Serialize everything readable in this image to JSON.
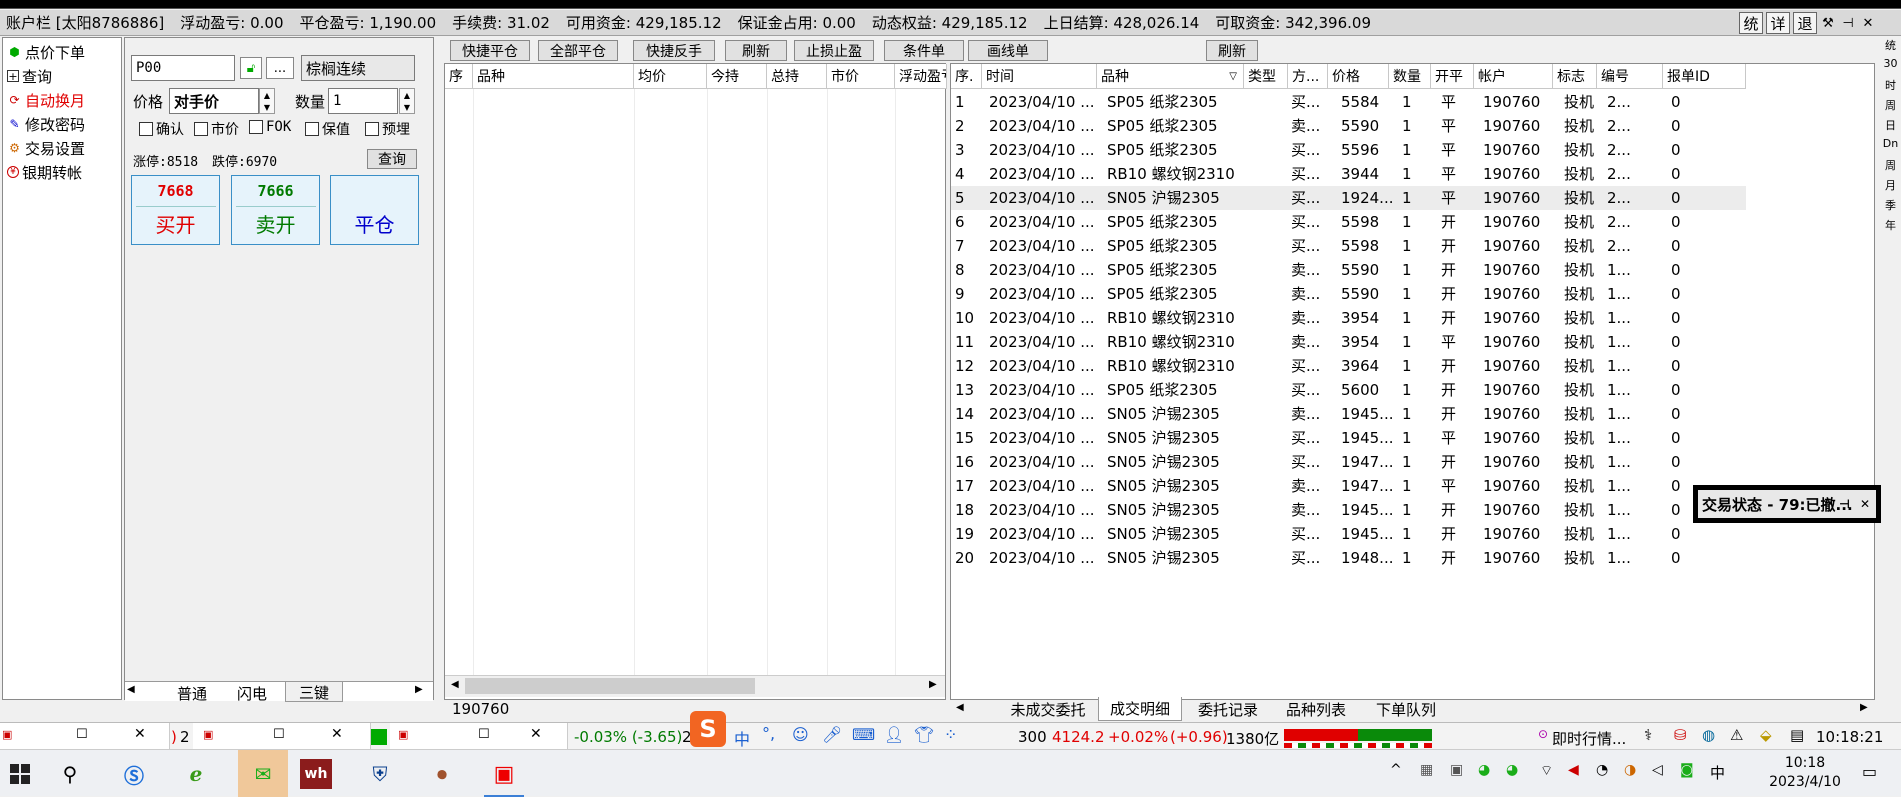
{
  "account_bar": {
    "title": "账户栏 [太阳8786886]",
    "floating_pl": "浮动盈亏: 0.00",
    "close_pl": "平仓盈亏: 1,190.00",
    "fee": "手续费: 31.02",
    "available": "可用资金: 429,185.12",
    "margin": "保证金占用: 0.00",
    "dynamic_equity": "动态权益: 429,185.12",
    "prev_settle": "上日结算: 428,026.14",
    "withdrawable": "可取资金: 342,396.09",
    "btn_stat": "统",
    "btn_detail": "详",
    "btn_exit": "退"
  },
  "left_nav": {
    "items": [
      {
        "label": "点价下单",
        "icon": "green-dot-icon",
        "color": "#000000"
      },
      {
        "label": "查询",
        "icon": "plus-box-icon",
        "color": "#000000"
      },
      {
        "label": "自动换月",
        "icon": "cycle-icon",
        "color": "#e00000"
      },
      {
        "label": "修改密码",
        "icon": "edit-icon",
        "color": "#000000"
      },
      {
        "label": "交易设置",
        "icon": "gear-icon",
        "color": "#000000"
      },
      {
        "label": "银期转帐",
        "icon": "money-icon",
        "color": "#000000"
      }
    ]
  },
  "order_panel": {
    "contract_code": "P00",
    "contract_name": "棕榈连续",
    "more": "...",
    "price_label": "价格",
    "price_value": "对手价",
    "qty_label": "数量",
    "qty_value": "1",
    "checks": [
      "确认",
      "市价",
      "FOK",
      "保值",
      "预埋"
    ],
    "limit_up": "涨停:8518",
    "limit_down": "跌停:6970",
    "query_btn": "查询",
    "buy_price": "7668",
    "buy_label": "买开",
    "sell_price": "7666",
    "sell_label": "卖开",
    "close_label": "平仓",
    "tabs": [
      "普通",
      "闪电",
      "三键"
    ],
    "account_no": "190760"
  },
  "toolbar": {
    "quick_close": "快捷平仓",
    "close_all": "全部平仓",
    "quick_reverse": "快捷反手",
    "refresh": "刷新",
    "stop": "止损止盈",
    "conditional": "条件单",
    "draw": "画线单",
    "refresh2": "刷新"
  },
  "positions_table": {
    "headers": [
      "序",
      "品种",
      "均价",
      "今持",
      "总持",
      "市价",
      "浮动盈亏"
    ]
  },
  "trades_table": {
    "headers": [
      "序.",
      "时间",
      "品种",
      "类型",
      "方...",
      "价格",
      "数量",
      "开平",
      "帐户",
      "标志",
      "编号",
      "报单ID"
    ],
    "rows": [
      [
        "1",
        "2023/04/10 ...",
        "SP05 纸浆2305",
        "",
        "买...",
        "5584",
        "1",
        "平",
        "190760",
        "投机",
        "2...",
        "0"
      ],
      [
        "2",
        "2023/04/10 ...",
        "SP05 纸浆2305",
        "",
        "卖...",
        "5590",
        "1",
        "平",
        "190760",
        "投机",
        "2...",
        "0"
      ],
      [
        "3",
        "2023/04/10 ...",
        "SP05 纸浆2305",
        "",
        "买...",
        "5596",
        "1",
        "平",
        "190760",
        "投机",
        "2...",
        "0"
      ],
      [
        "4",
        "2023/04/10 ...",
        "RB10 螺纹钢2310",
        "",
        "买...",
        "3944",
        "1",
        "平",
        "190760",
        "投机",
        "2...",
        "0"
      ],
      [
        "5",
        "2023/04/10 ...",
        "SN05 沪锡2305",
        "",
        "买...",
        "1924...",
        "1",
        "平",
        "190760",
        "投机",
        "2...",
        "0"
      ],
      [
        "6",
        "2023/04/10 ...",
        "SP05 纸浆2305",
        "",
        "买...",
        "5598",
        "1",
        "开",
        "190760",
        "投机",
        "2...",
        "0"
      ],
      [
        "7",
        "2023/04/10 ...",
        "SP05 纸浆2305",
        "",
        "买...",
        "5598",
        "1",
        "开",
        "190760",
        "投机",
        "2...",
        "0"
      ],
      [
        "8",
        "2023/04/10 ...",
        "SP05 纸浆2305",
        "",
        "卖...",
        "5590",
        "1",
        "开",
        "190760",
        "投机",
        "1...",
        "0"
      ],
      [
        "9",
        "2023/04/10 ...",
        "SP05 纸浆2305",
        "",
        "卖...",
        "5590",
        "1",
        "开",
        "190760",
        "投机",
        "1...",
        "0"
      ],
      [
        "10",
        "2023/04/10 ...",
        "RB10 螺纹钢2310",
        "",
        "卖...",
        "3954",
        "1",
        "开",
        "190760",
        "投机",
        "1...",
        "0"
      ],
      [
        "11",
        "2023/04/10 ...",
        "RB10 螺纹钢2310",
        "",
        "卖...",
        "3954",
        "1",
        "平",
        "190760",
        "投机",
        "1...",
        "0"
      ],
      [
        "12",
        "2023/04/10 ...",
        "RB10 螺纹钢2310",
        "",
        "买...",
        "3964",
        "1",
        "开",
        "190760",
        "投机",
        "1...",
        "0"
      ],
      [
        "13",
        "2023/04/10 ...",
        "SP05 纸浆2305",
        "",
        "买...",
        "5600",
        "1",
        "开",
        "190760",
        "投机",
        "1...",
        "0"
      ],
      [
        "14",
        "2023/04/10 ...",
        "SN05 沪锡2305",
        "",
        "卖...",
        "1945...",
        "1",
        "开",
        "190760",
        "投机",
        "1...",
        "0"
      ],
      [
        "15",
        "2023/04/10 ...",
        "SN05 沪锡2305",
        "",
        "买...",
        "1945...",
        "1",
        "平",
        "190760",
        "投机",
        "1...",
        "0"
      ],
      [
        "16",
        "2023/04/10 ...",
        "SN05 沪锡2305",
        "",
        "买...",
        "1947...",
        "1",
        "开",
        "190760",
        "投机",
        "1...",
        "0"
      ],
      [
        "17",
        "2023/04/10 ...",
        "SN05 沪锡2305",
        "",
        "卖...",
        "1947...",
        "1",
        "平",
        "190760",
        "投机",
        "1...",
        "0"
      ],
      [
        "18",
        "2023/04/10 ...",
        "SN05 沪锡2305",
        "",
        "卖...",
        "1945...",
        "1",
        "开",
        "190760",
        "投机",
        "1...",
        "0"
      ],
      [
        "19",
        "2023/04/10 ...",
        "SN05 沪锡2305",
        "",
        "买...",
        "1945...",
        "1",
        "开",
        "190760",
        "投机",
        "1...",
        "0"
      ],
      [
        "20",
        "2023/04/10 ...",
        "SN05 沪锡2305",
        "",
        "买...",
        "1948...",
        "1",
        "开",
        "190760",
        "投机",
        "1...",
        "0"
      ]
    ]
  },
  "bottom_tabs": [
    "未成交委托",
    "成交明细",
    "委托记录",
    "品种列表",
    "下单队列"
  ],
  "popup": {
    "text": "交易状态 - 79:已撤...",
    "pin": "⊣",
    "close": "✕"
  },
  "status_strip": {
    "left_red": ")",
    "left_num": "2",
    "change_pct": "-0.03% (-3.65)",
    "mid_num": "2",
    "index_code": "300",
    "index_value": "4124.2",
    "index_pct": "+0.02%",
    "index_chg": "(+0.96)",
    "volume": "1380亿",
    "quote_label": "即时行情...",
    "clock": "10:18:21"
  },
  "right_edge": [
    "统",
    "30",
    "时",
    "周",
    "日",
    "Dn",
    "周",
    "月",
    "季",
    "年"
  ],
  "taskbar": {
    "time": "10:18",
    "date": "2023/4/10",
    "ime": "中"
  },
  "colors": {
    "red": "#e00000",
    "green": "#007a00",
    "blue": "#0000cc",
    "accent": "#3a8fc7"
  }
}
